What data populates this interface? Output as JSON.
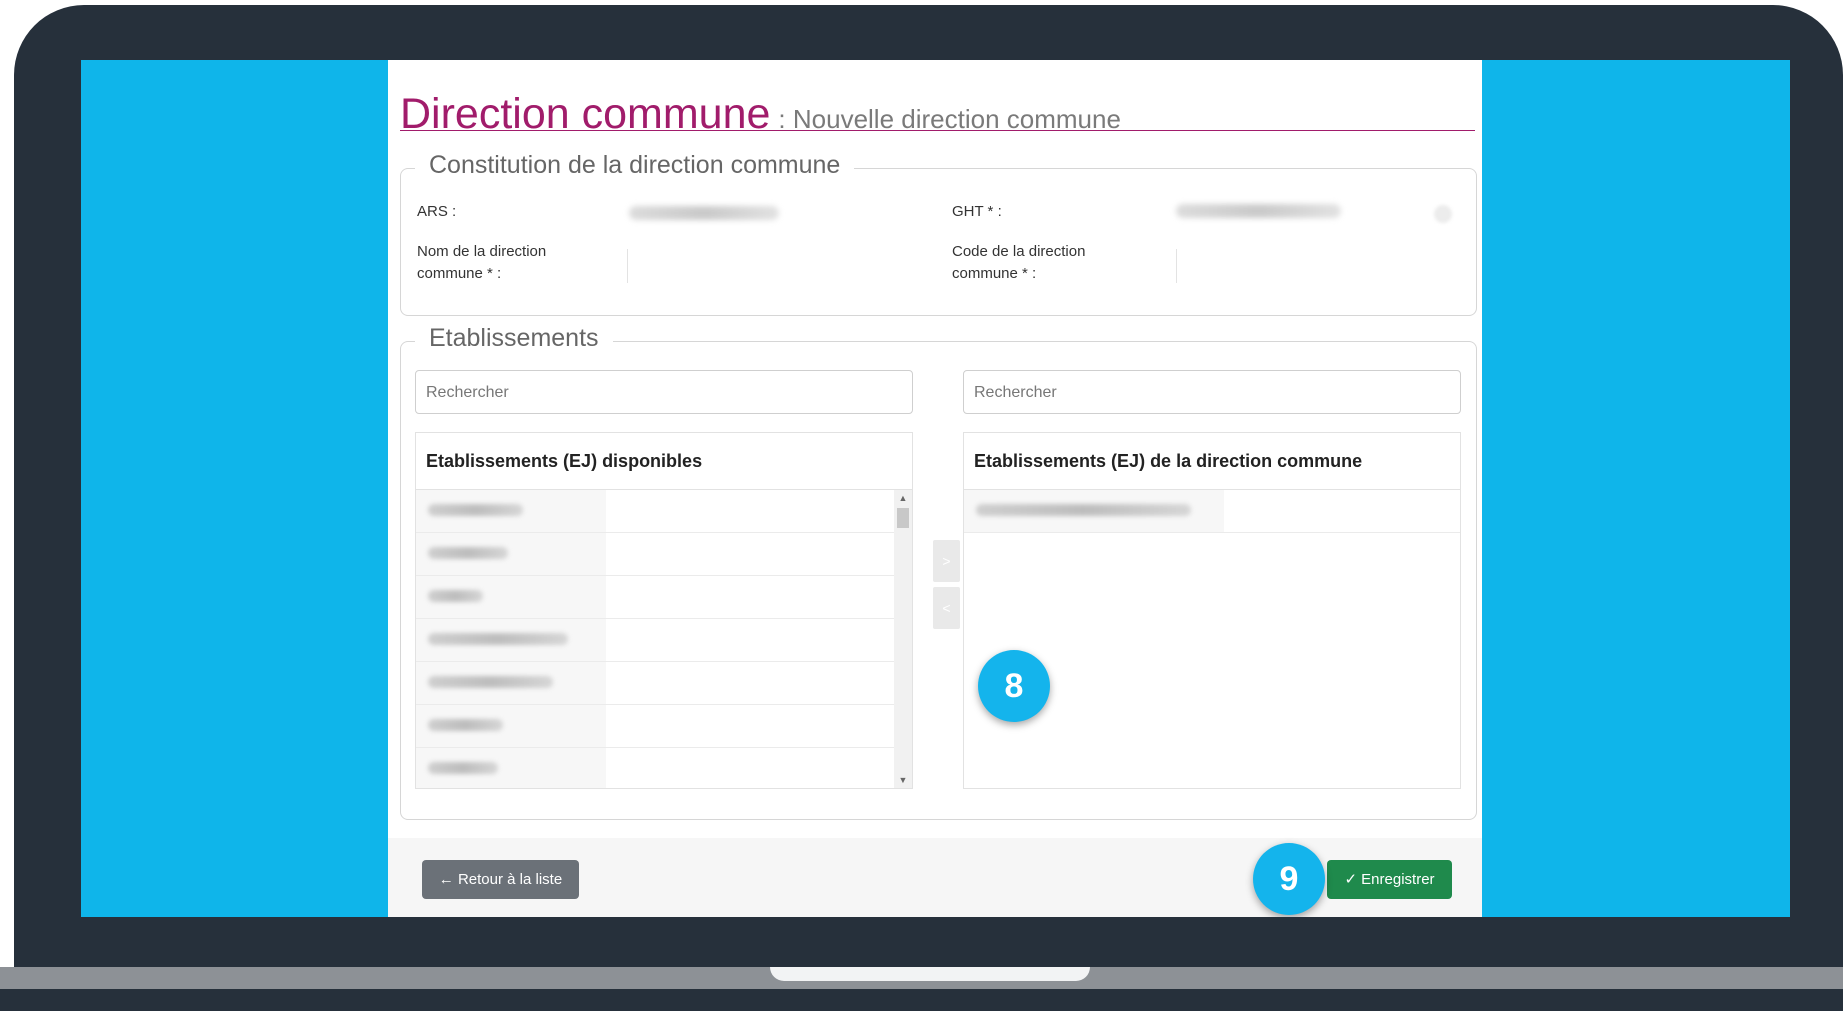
{
  "page": {
    "title": "Direction commune",
    "subtitle": ": Nouvelle direction commune"
  },
  "constitution": {
    "legend": "Constitution de la direction commune",
    "ars_label": "ARS :",
    "ght_label": "GHT * :",
    "nom_label_line1": "Nom de la direction",
    "nom_label_line2": "commune * :",
    "code_label_line1": "Code de la direction",
    "code_label_line2": "commune * :"
  },
  "etablissements": {
    "legend": "Etablissements",
    "left_search_placeholder": "Rechercher",
    "right_search_placeholder": "Rechercher",
    "left_header": "Etablissements (EJ) disponibles",
    "right_header": "Etablissements (EJ) de la direction commune",
    "move_right_label": ">",
    "move_left_label": "<"
  },
  "footer": {
    "back_label": "← Retour à la liste",
    "save_label": "✓ Enregistrer"
  },
  "callouts": {
    "first": "8",
    "second": "9"
  },
  "colors": {
    "title": "#a11c6b",
    "screen_background": "#0fb5ea",
    "laptop_frame": "#26303b",
    "save_button": "#1f8a4c",
    "back_button": "#6b7178",
    "callout": "#14b4ec"
  }
}
